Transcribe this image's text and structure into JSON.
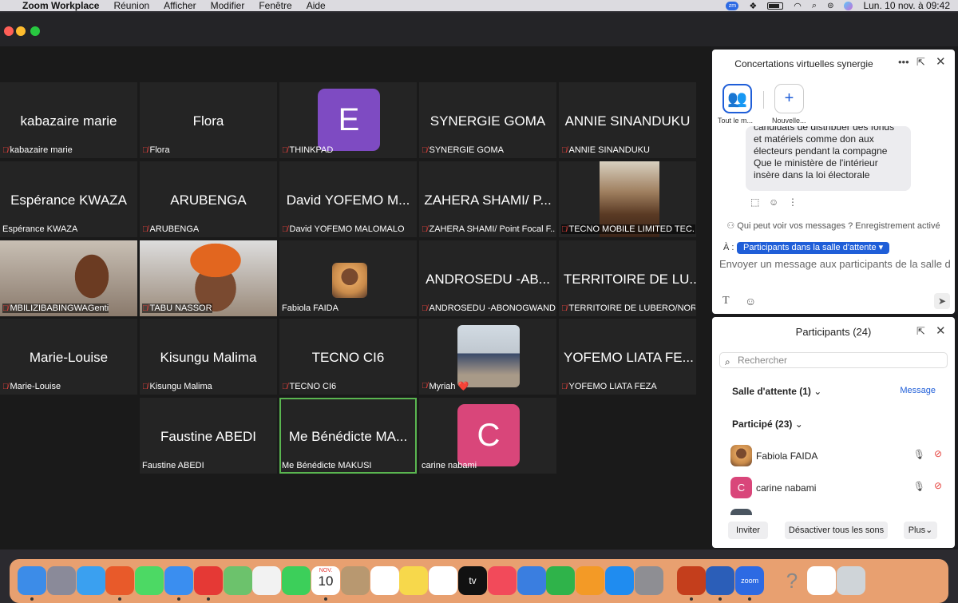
{
  "menubar": {
    "apple": "",
    "app_name": "Zoom Workplace",
    "menus": [
      "Réunion",
      "Afficher",
      "Modifier",
      "Fenêtre",
      "Aide"
    ],
    "zoom_badge": "zm",
    "datetime": "Lun. 10 nov. à 09:42"
  },
  "tiles": [
    {
      "big": "kabazaire marie",
      "label": "kabazaire marie",
      "muted": true
    },
    {
      "big": "Flora",
      "label": "Flora",
      "muted": true
    },
    {
      "avatar_letter": "E",
      "avatar_color": "#7e4bc2",
      "label": "THINKPAD",
      "muted": true
    },
    {
      "big": "SYNERGIE GOMA",
      "label": "SYNERGIE GOMA",
      "muted": true
    },
    {
      "big": "ANNIE SINANDUKU",
      "label": "ANNIE SINANDUKU",
      "muted": true
    },
    {
      "big": "Espérance KWAZA",
      "label": "Espérance KWAZA",
      "muted": false
    },
    {
      "big": "ARUBENGA",
      "label": "ARUBENGA",
      "muted": true
    },
    {
      "big": "David YOFEMO M...",
      "label": "David YOFEMO MALOMALO",
      "muted": true
    },
    {
      "big": "ZAHERA SHAMI/ P...",
      "label": "ZAHERA SHAMI/ Point Focal F...",
      "muted": true
    },
    {
      "photo": "video-kitchen",
      "label": "TECNO MOBILE LIMITED TEC...",
      "muted": true
    },
    {
      "photo": "video-woman-braids",
      "label": "MBILIZIBABINGWAGenti",
      "muted": true
    },
    {
      "photo": "video-woman-headwrap",
      "label": "TABU NASSOR",
      "muted": true
    },
    {
      "photo": "small-avatar-fabiola",
      "label": "Fabiola FAIDA",
      "muted": false
    },
    {
      "big": "ANDROSEDU -AB...",
      "label": "ANDROSEDU -ABONOGWAND...",
      "muted": true
    },
    {
      "big": "TERRITOIRE DE LU...",
      "label": "TERRITOIRE DE LUBERO/NOR...",
      "muted": true
    },
    {
      "big": "Marie-Louise",
      "label": "Marie-Louise",
      "muted": true
    },
    {
      "big": "Kisungu Malima",
      "label": "Kisungu Malima",
      "muted": true
    },
    {
      "big": "TECNO CI6",
      "label": "TECNO CI6",
      "muted": true
    },
    {
      "photo": "small-avatar-myriah",
      "label": "Myriah ❤️",
      "muted": true
    },
    {
      "big": "YOFEMO LIATA FE...",
      "label": "YOFEMO LIATA FEZA",
      "muted": true
    },
    {
      "big": "Faustine ABEDI",
      "label": "Faustine ABEDI",
      "muted": false
    },
    {
      "big": "Me Bénédicte MA...",
      "label": "Me Bénédicte MAKUSI",
      "muted": false,
      "active": true
    },
    {
      "avatar_letter": "C",
      "avatar_color": "#d9467a",
      "label": "carine nabami",
      "muted": false
    }
  ],
  "chat": {
    "title": "Concertations virtuelles synergie",
    "all_caption": "Tout le m...",
    "new_caption": "Nouvelle...",
    "message_lines": [
      "candidats de distribuer  des fonds",
      "et matériels  comme don aux",
      "électeurs pendant la compagne",
      "Que le  ministère de l'intérieur",
      "insère dans la loi électorale"
    ],
    "visibility": "Qui peut voir vos messages ? Enregistrement activé",
    "to_label": "À :",
    "recipient": "Participants dans la salle d'attente ▾",
    "composer_placeholder": "Envoyer un message aux participants de la salle d'a..."
  },
  "participants": {
    "title": "Participants (24)",
    "search_placeholder": "Rechercher",
    "waiting_room": "Salle d'attente (1)",
    "message_link": "Message",
    "in_meeting": "Participé (23)",
    "rows": [
      {
        "name": "Fabiola FAIDA",
        "avatar": "photo",
        "color": "#b06a3a"
      },
      {
        "name": "carine nabami",
        "avatar": "C",
        "color": "#d9467a"
      }
    ],
    "invite": "Inviter",
    "mute_all": "Désactiver tous les sons",
    "more": "Plus"
  },
  "dock": {
    "calendar_month": "NOV.",
    "calendar_day": "10",
    "apps": [
      "finder-icon",
      "launchpad-icon",
      "safari-icon",
      "firefox-icon",
      "messages-icon",
      "mail-icon",
      "pdf-icon",
      "maps-icon",
      "photos-icon",
      "facetime-icon",
      "calendar-icon",
      "contacts-icon",
      "reminders-icon",
      "notes-icon",
      "freeform-icon",
      "appletv-icon",
      "music-icon",
      "keynote-icon",
      "numbers-icon",
      "pages-icon",
      "appstore-icon",
      "settings-icon",
      "powerpoint-icon",
      "word-icon",
      "zoom-icon",
      "help-icon",
      "preview-icon",
      "trash-icon"
    ],
    "zoom_label": "zoom",
    "tv_label": "tv"
  }
}
